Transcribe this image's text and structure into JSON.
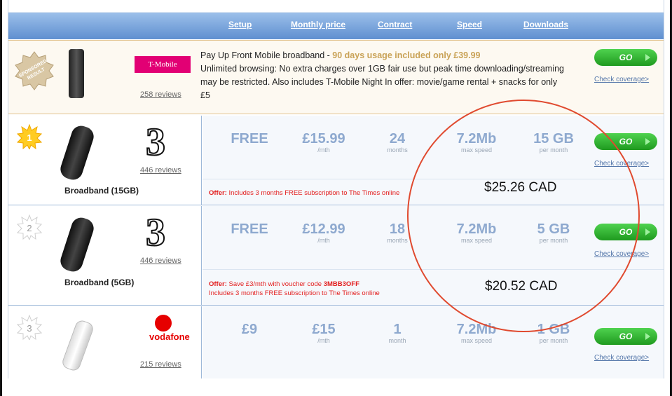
{
  "header": {
    "columns": [
      "Setup",
      "Monthly price",
      "Contract",
      "Speed",
      "Downloads"
    ]
  },
  "sponsored": {
    "badge": "SPONSORED RESULT",
    "brand": "T-Mobile",
    "reviews": "258 reviews",
    "title_prefix": "Pay Up Front Mobile broadband - ",
    "title_highlight": "90 days usage included only £39.99",
    "desc": "Unlimited browsing: No extra charges over 1GB fair use but peak time downloading/streaming may be restricted. Also includes T-Mobile Night In offer: movie/game rental + snacks for only £5",
    "go": "GO",
    "coverage": "Check coverage>"
  },
  "rows": [
    {
      "rank": "1",
      "reviews": "446 reviews",
      "name": "Broadband (15GB)",
      "setup": "FREE",
      "price": "£15.99",
      "price_unit": "/mth",
      "contract": "24",
      "contract_unit": "months",
      "speed": "7.2Mb",
      "speed_unit": "max speed",
      "downloads": "15 GB",
      "downloads_unit": "per month",
      "offer_label": "Offer:",
      "offer_text": " Includes 3 months FREE subscription to The Times online",
      "cad": "$25.26 CAD",
      "go": "GO",
      "coverage": "Check coverage>"
    },
    {
      "rank": "2",
      "reviews": "446 reviews",
      "name": "Broadband (5GB)",
      "setup": "FREE",
      "price": "£12.99",
      "price_unit": "/mth",
      "contract": "18",
      "contract_unit": "months",
      "speed": "7.2Mb",
      "speed_unit": "max speed",
      "downloads": "5 GB",
      "downloads_unit": "per month",
      "offer_label": "Offer:",
      "offer_text": " Save £3/mth with voucher code ",
      "offer_code": "3MBB3OFF",
      "offer_line2": "Includes 3 months FREE subscription to The Times online",
      "cad": "$20.52 CAD",
      "go": "GO",
      "coverage": "Check coverage>"
    },
    {
      "rank": "3",
      "brand": "vodafone",
      "reviews": "215 reviews",
      "setup": "£9",
      "price": "£15",
      "price_unit": "/mth",
      "contract": "1",
      "contract_unit": "month",
      "speed": "7.2Mb",
      "speed_unit": "max speed",
      "downloads": "1 GB",
      "downloads_unit": "per month",
      "go": "GO",
      "coverage": "Check coverage>"
    }
  ],
  "colors": {
    "accent_header": "#6f9bd6",
    "go_green": "#2db02d",
    "offer_red": "#e31e1e",
    "annotation_red": "#e04a2f"
  }
}
